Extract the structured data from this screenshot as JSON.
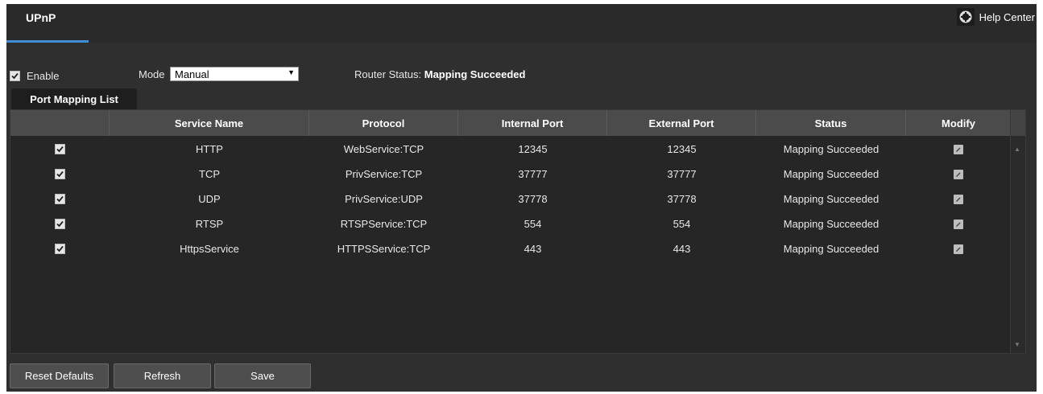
{
  "header": {
    "tab_label": "UPnP",
    "help_label": "Help Center"
  },
  "controls": {
    "enable_label": "Enable",
    "enable_checked": true,
    "mode_label": "Mode",
    "mode_value": "Manual",
    "router_status_label": "Router Status:",
    "router_status_value": "Mapping Succeeded"
  },
  "list_tab": "Port Mapping List",
  "table": {
    "columns": [
      "",
      "Service Name",
      "Protocol",
      "Internal Port",
      "External Port",
      "Status",
      "Modify"
    ],
    "rows": [
      {
        "service": "HTTP",
        "protocol": "WebService:TCP",
        "internal": "12345",
        "external": "12345",
        "status": "Mapping Succeeded"
      },
      {
        "service": "TCP",
        "protocol": "PrivService:TCP",
        "internal": "37777",
        "external": "37777",
        "status": "Mapping Succeeded"
      },
      {
        "service": "UDP",
        "protocol": "PrivService:UDP",
        "internal": "37778",
        "external": "37778",
        "status": "Mapping Succeeded"
      },
      {
        "service": "RTSP",
        "protocol": "RTSPService:TCP",
        "internal": "554",
        "external": "554",
        "status": "Mapping Succeeded"
      },
      {
        "service": "HttpsService",
        "protocol": "HTTPSService:TCP",
        "internal": "443",
        "external": "443",
        "status": "Mapping Succeeded"
      }
    ]
  },
  "buttons": {
    "reset": "Reset Defaults",
    "refresh": "Refresh",
    "save": "Save"
  },
  "icons": [
    "help-icon",
    "checkbox-icon",
    "dropdown-arrow-icon",
    "edit-icon",
    "scroll-up-icon",
    "scroll-down-icon"
  ],
  "colors": {
    "accent": "#3f8fd6",
    "panel": "#2f2f2f",
    "header_row": "#4b4b4b"
  }
}
